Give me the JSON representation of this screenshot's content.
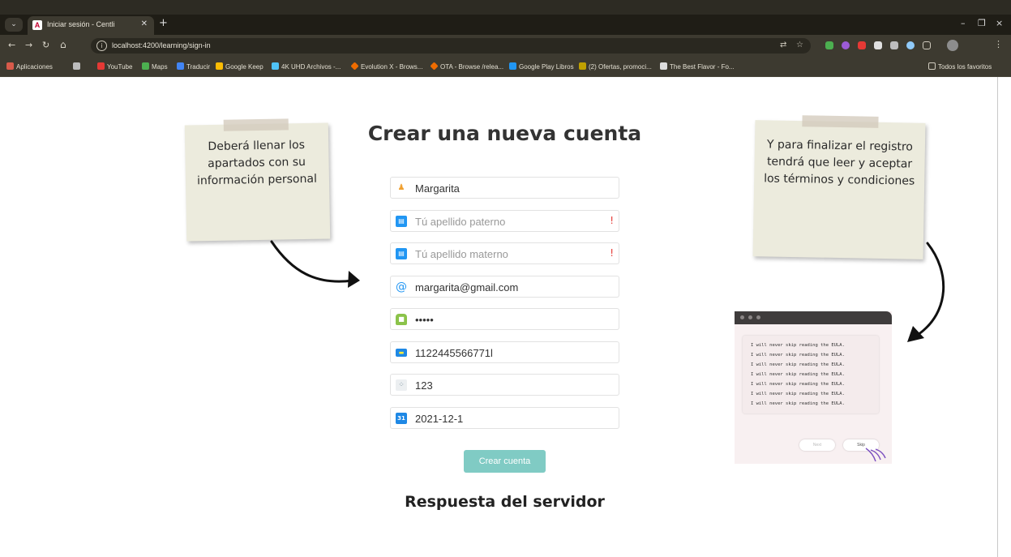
{
  "browser": {
    "tab_title": "Iniciar sesión - Centli",
    "new_tab": "+",
    "url": "localhost:4200/learning/sign-in",
    "window_controls": [
      "–",
      "❐",
      "×"
    ],
    "bookmarks": [
      {
        "label": "Aplicaciones",
        "icon": "apps-grid-icon",
        "color": "#d85a4a"
      },
      {
        "label": "YouTube",
        "icon": "youtube-icon",
        "color": "#e53935"
      },
      {
        "label": "Maps",
        "icon": "maps-pin-icon",
        "color": "#4caf50"
      },
      {
        "label": "Traducir",
        "icon": "translate-icon",
        "color": "#4285f4"
      },
      {
        "label": "Google Keep",
        "icon": "keep-icon",
        "color": "#fbbc04"
      },
      {
        "label": "4K UHD Archivos -...",
        "icon": "archive-icon",
        "color": "#4fc3f7"
      },
      {
        "label": "Evolution X - Brows...",
        "icon": "orange-diamond-icon",
        "color": "#ef6c00"
      },
      {
        "label": "OTA - Browse /relea...",
        "icon": "orange-diamond-icon",
        "color": "#ef6c00"
      },
      {
        "label": "Google Play Libros",
        "icon": "play-books-icon",
        "color": "#2196f3"
      },
      {
        "label": "(2) Ofertas, promoci...",
        "icon": "offers-icon",
        "color": "#c0a000"
      },
      {
        "label": "The Best Flavor - Fo...",
        "icon": "angular-icon",
        "color": "#dddddd"
      }
    ],
    "all_bookmarks": "Todos los favoritos"
  },
  "page": {
    "title": "Crear una nueva cuenta",
    "fields": [
      {
        "name": "first-name",
        "value": "Margarita",
        "placeholder": "",
        "icon": "person-icon",
        "icon_color": "#f0a030",
        "warn": ""
      },
      {
        "name": "paternal-surname",
        "value": "",
        "placeholder": "Tú apellido paterno",
        "icon": "id-card-icon",
        "icon_color": "#2196f3",
        "warn": "!"
      },
      {
        "name": "maternal-surname",
        "value": "",
        "placeholder": "Tú apellido materno",
        "icon": "id-card-icon",
        "icon_color": "#2196f3",
        "warn": "!"
      },
      {
        "name": "email",
        "value": "margarita@gmail.com",
        "placeholder": "",
        "icon": "at-icon",
        "icon_color": "#2196f3",
        "warn": ""
      },
      {
        "name": "password",
        "value": "•••••",
        "placeholder": "",
        "icon": "lock-icon",
        "icon_color": "#8bc34a",
        "warn": ""
      },
      {
        "name": "card-number",
        "value": "1122445566771l",
        "placeholder": "",
        "icon": "credit-card-icon",
        "icon_color": "#1e88e5",
        "warn": ""
      },
      {
        "name": "cvv",
        "value": "123",
        "placeholder": "",
        "icon": "keypad-icon",
        "icon_color": "#78909c",
        "warn": ""
      },
      {
        "name": "expiry-date",
        "value": "2021-12-1",
        "placeholder": "",
        "icon": "calendar-icon",
        "icon_color": "#1e88e5",
        "warn": ""
      }
    ],
    "submit_label": "Crear cuenta",
    "server_response_title": "Respuesta del servidor"
  },
  "notes": {
    "left": "Deberá llenar los apartados con su información personal",
    "right": "Y para finalizar el registro tendrá que leer y aceptar los términos y condiciones"
  },
  "eula": {
    "lines": [
      "I will never skip reading the EULA.",
      "I will never skip reading the EULA.",
      "I will never skip reading the EULA.",
      "I will never skip reading the EULA.",
      "I will never skip reading the EULA.",
      "I will never skip reading the EULA.",
      "I will never skip reading the EULA."
    ],
    "left_button": "Next",
    "right_button": "Skip"
  }
}
